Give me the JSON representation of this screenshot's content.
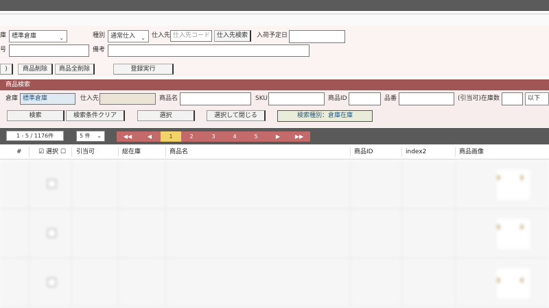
{
  "header": {},
  "form": {
    "warehouse_label": "庫",
    "warehouse_value": "標準倉庫",
    "type_label": "種別",
    "type_value": "通常仕入",
    "supplier_label": "仕入先",
    "supplier_placeholder": "仕入先コード",
    "supplier_search_btn": "仕入先検索",
    "arrival_label": "入荷予定日",
    "arrival_value": "",
    "number_label": "号",
    "number_value": "",
    "note_label": "備考",
    "note_value": "",
    "btn_partial": ")",
    "btn_delete_item": "商品削除",
    "btn_delete_all": "商品全削除",
    "btn_register": "登録実行"
  },
  "search": {
    "section_title": "商品検索",
    "warehouse_label": "倉庫",
    "warehouse_value": "標準倉庫",
    "supplier_label": "仕入先",
    "supplier_value": "",
    "product_name_label": "商品名",
    "sku_label": "SKU",
    "product_id_label": "商品ID",
    "product_no_label": "品番",
    "stock_label": "(引当可)在庫数",
    "stock_cmp_value": "以下",
    "btn_search": "検索",
    "btn_clear": "検索条件クリア",
    "btn_select": "選択",
    "btn_select_close": "選択して閉じる",
    "search_type": "検索種別：倉庫在庫"
  },
  "pager": {
    "count_text": "1 - 5 / 1176件",
    "per_page": "5 件",
    "first": "◀◀",
    "prev": "◀",
    "pages": [
      "1",
      "2",
      "3",
      "4",
      "5"
    ],
    "current_page": "1",
    "next": "▶",
    "last": "▶▶"
  },
  "table": {
    "columns": {
      "num": "#",
      "select": "選択",
      "allocatable": "引当可",
      "total_stock": "総在庫",
      "product_name": "商品名",
      "product_id": "商品ID",
      "index2": "index2",
      "product_image": "商品画像"
    }
  },
  "icons": {
    "checkbox_checked": "☑",
    "checkbox_empty": "☐",
    "caret": "⌄"
  }
}
